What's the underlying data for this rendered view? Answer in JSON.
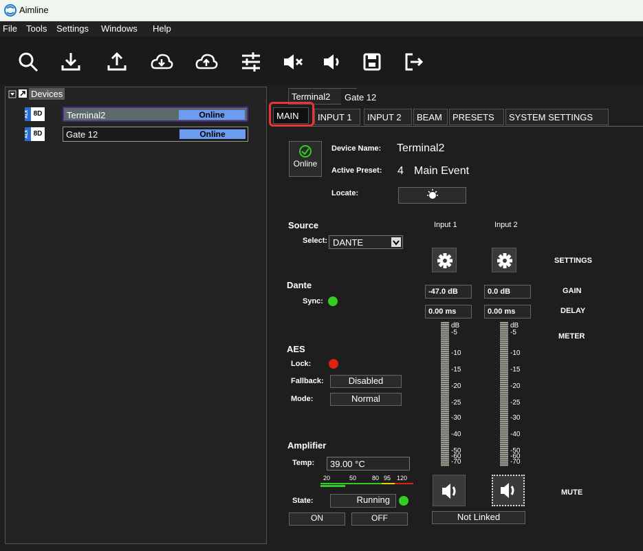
{
  "app": {
    "title": "Aimline"
  },
  "menu": [
    "File",
    "Tools",
    "Settings",
    "Windows",
    "Help"
  ],
  "toolbar_icons": [
    "search-icon",
    "download-icon",
    "upload-icon",
    "cloud-download-icon",
    "cloud-upload-icon",
    "sliders-icon",
    "mute-icon",
    "speaker-icon",
    "save-icon",
    "exit-icon"
  ],
  "tree": {
    "root_label": "Devices",
    "devices": [
      {
        "alx": "ALX",
        "badge": "8D",
        "name": "Terminal2",
        "status": "Online",
        "selected": true
      },
      {
        "alx": "ALX",
        "badge": "8D",
        "name": "Gate 12",
        "status": "Online",
        "selected": false
      }
    ]
  },
  "device_tabs": [
    "Terminal2",
    "Gate 12"
  ],
  "sub_tabs": [
    "MAIN",
    "INPUT 1",
    "INPUT 2",
    "BEAM",
    "PRESETS",
    "SYSTEM SETTINGS"
  ],
  "main": {
    "status_label": "Online",
    "device_name_label": "Device Name:",
    "device_name": "Terminal2",
    "active_preset_label": "Active Preset:",
    "active_preset_number": "4",
    "active_preset_name": "Main Event",
    "locate_label": "Locate:"
  },
  "source": {
    "title": "Source",
    "select_label": "Select:",
    "select_value": "DANTE"
  },
  "dante": {
    "title": "Dante",
    "sync_label": "Sync:",
    "sync_color": "#33cc22"
  },
  "aes": {
    "title": "AES",
    "lock_label": "Lock:",
    "lock_color": "#dd2211",
    "fallback_label": "Fallback:",
    "fallback_value": "Disabled",
    "mode_label": "Mode:",
    "mode_value": "Normal"
  },
  "amplifier": {
    "title": "Amplifier",
    "temp_label": "Temp:",
    "temp_value": "39.00 °C",
    "scale": [
      "20",
      "50",
      "80",
      "95",
      "120"
    ],
    "state_label": "State:",
    "state_value": "Running",
    "state_color": "#33cc22",
    "on_label": "ON",
    "off_label": "OFF"
  },
  "inputs": {
    "labels": [
      "Input 1",
      "Input 2"
    ],
    "gains": [
      "-47.0 dB",
      "0.0 dB"
    ],
    "delays": [
      "0.00 ms",
      "0.00 ms"
    ],
    "meter_scale": [
      "dB",
      "-5",
      "-10",
      "-15",
      "-20",
      "-25",
      "-30",
      "-40",
      "-50",
      "-60",
      "-70"
    ],
    "link": "Not Linked"
  },
  "row_labels": {
    "settings": "SETTINGS",
    "gain": "GAIN",
    "delay": "DELAY",
    "meter": "METER",
    "mute": "MUTE"
  }
}
